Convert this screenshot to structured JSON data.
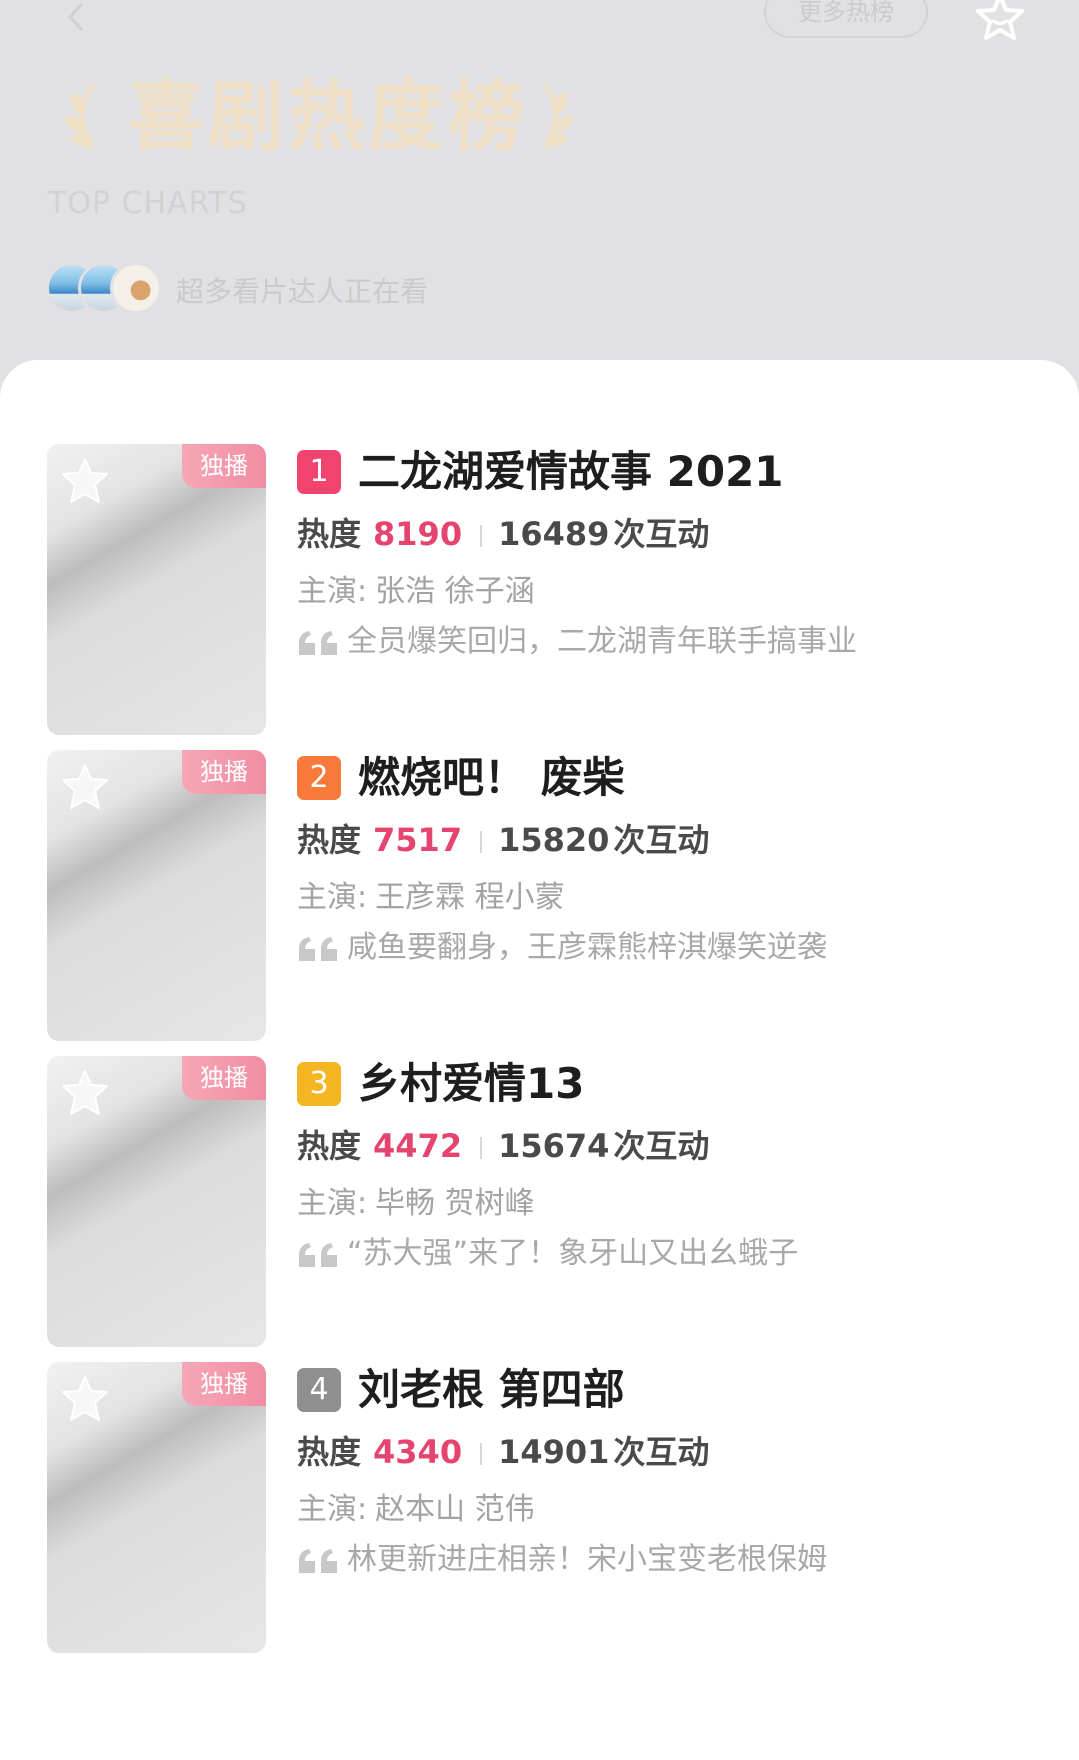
{
  "header": {
    "more_label": "更多热榜",
    "title": "喜剧热度榜",
    "subtitle": "TOP CHARTS",
    "watching_text": "超多看片达人正在看"
  },
  "colors": {
    "rank1": "#f0436e",
    "rank2": "#f87a3a",
    "rank3": "#f6b624",
    "rank4": "#8f8f8f",
    "heat": "#e5446f"
  },
  "items": [
    {
      "rank": "1",
      "tag": "独播",
      "title": "二龙湖爱情故事 2021",
      "heat_label": "热度",
      "heat": "8190",
      "interactions": "16489",
      "interactions_unit": "次互动",
      "cast_label": "主演:",
      "cast": "张浩 徐子涵",
      "quote": "全员爆笑回归，二龙湖青年联手搞事业"
    },
    {
      "rank": "2",
      "tag": "独播",
      "title": "燃烧吧！ 废柴",
      "heat_label": "热度",
      "heat": "7517",
      "interactions": "15820",
      "interactions_unit": "次互动",
      "cast_label": "主演:",
      "cast": "王彦霖 程小蒙",
      "quote": "咸鱼要翻身，王彦霖熊梓淇爆笑逆袭"
    },
    {
      "rank": "3",
      "tag": "独播",
      "title": "乡村爱情13",
      "heat_label": "热度",
      "heat": "4472",
      "interactions": "15674",
      "interactions_unit": "次互动",
      "cast_label": "主演:",
      "cast": "毕畅 贺树峰",
      "quote": "“苏大强”来了！象牙山又出幺蛾子"
    },
    {
      "rank": "4",
      "tag": "独播",
      "title": "刘老根 第四部",
      "heat_label": "热度",
      "heat": "4340",
      "interactions": "14901",
      "interactions_unit": "次互动",
      "cast_label": "主演:",
      "cast": "赵本山 范伟",
      "quote": "林更新进庄相亲！宋小宝变老根保姆"
    }
  ]
}
